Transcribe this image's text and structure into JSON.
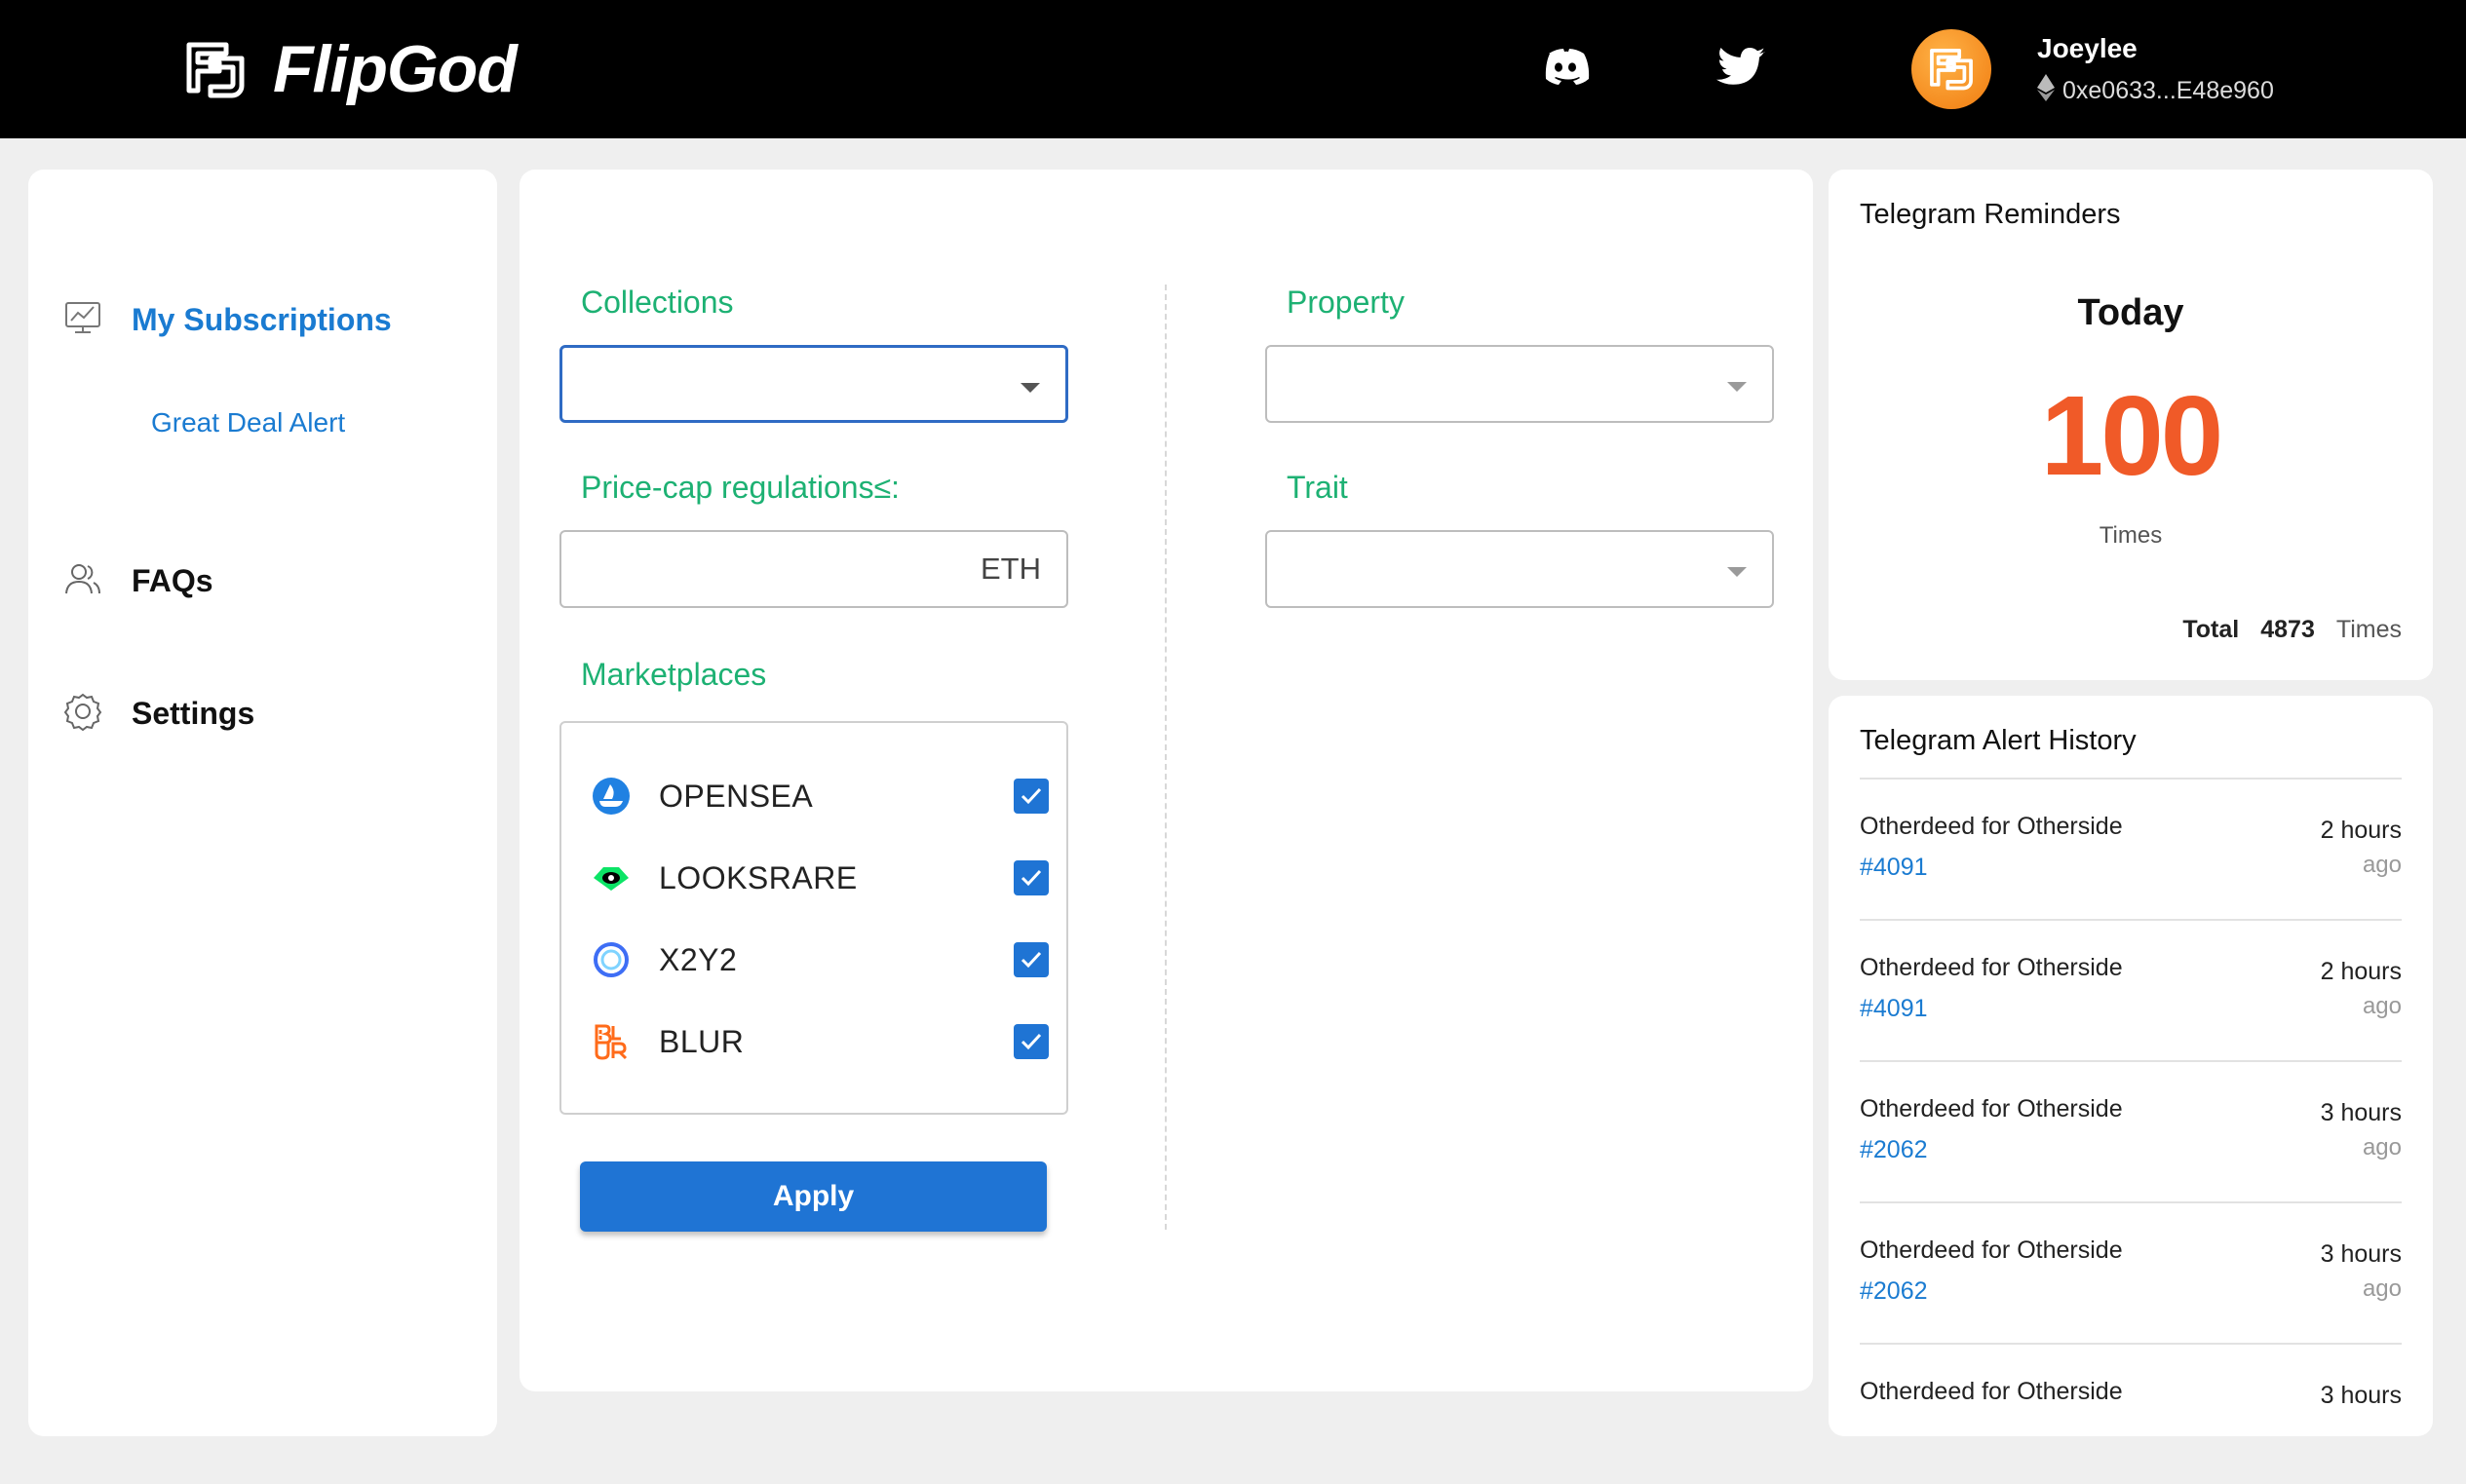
{
  "app": {
    "brand": "FlipGod"
  },
  "user": {
    "name": "Joeylee",
    "wallet": "0xe0633...E48e960"
  },
  "sidebar": {
    "items": [
      {
        "label": "My Subscriptions",
        "sub": "Great Deal Alert"
      },
      {
        "label": "FAQs"
      },
      {
        "label": "Settings"
      }
    ]
  },
  "form": {
    "collections_label": "Collections",
    "collections_value": "",
    "price_label": "Price-cap regulations≤:",
    "price_value": "",
    "price_unit": "ETH",
    "marketplaces_label": "Marketplaces",
    "marketplaces": [
      {
        "name": "OPENSEA",
        "checked": true,
        "icon": "opensea-icon"
      },
      {
        "name": "LOOKSRARE",
        "checked": true,
        "icon": "looksrare-icon"
      },
      {
        "name": "X2Y2",
        "checked": true,
        "icon": "x2y2-icon"
      },
      {
        "name": "BLUR",
        "checked": true,
        "icon": "blur-icon"
      }
    ],
    "property_label": "Property",
    "property_value": "",
    "trait_label": "Trait",
    "trait_value": "",
    "apply_label": "Apply"
  },
  "reminders": {
    "title": "Telegram Reminders",
    "today_label": "Today",
    "today_count": "100",
    "times_label": "Times",
    "total_label": "Total",
    "total_count": "4873",
    "total_unit": "Times"
  },
  "history": {
    "title": "Telegram Alert History",
    "items": [
      {
        "name": "Otherdeed for Otherside",
        "id": "#4091",
        "when": "2 hours",
        "ago": "ago"
      },
      {
        "name": "Otherdeed for Otherside",
        "id": "#4091",
        "when": "2 hours",
        "ago": "ago"
      },
      {
        "name": "Otherdeed for Otherside",
        "id": "#2062",
        "when": "3 hours",
        "ago": "ago"
      },
      {
        "name": "Otherdeed for Otherside",
        "id": "#2062",
        "when": "3 hours",
        "ago": "ago"
      },
      {
        "name": "Otherdeed for Otherside",
        "id": "",
        "when": "3 hours",
        "ago": ""
      }
    ]
  },
  "colors": {
    "accent": "#1f74d4",
    "label_green": "#1db173",
    "count_orange": "#f05a28",
    "link_blue": "#1a7bd1"
  }
}
